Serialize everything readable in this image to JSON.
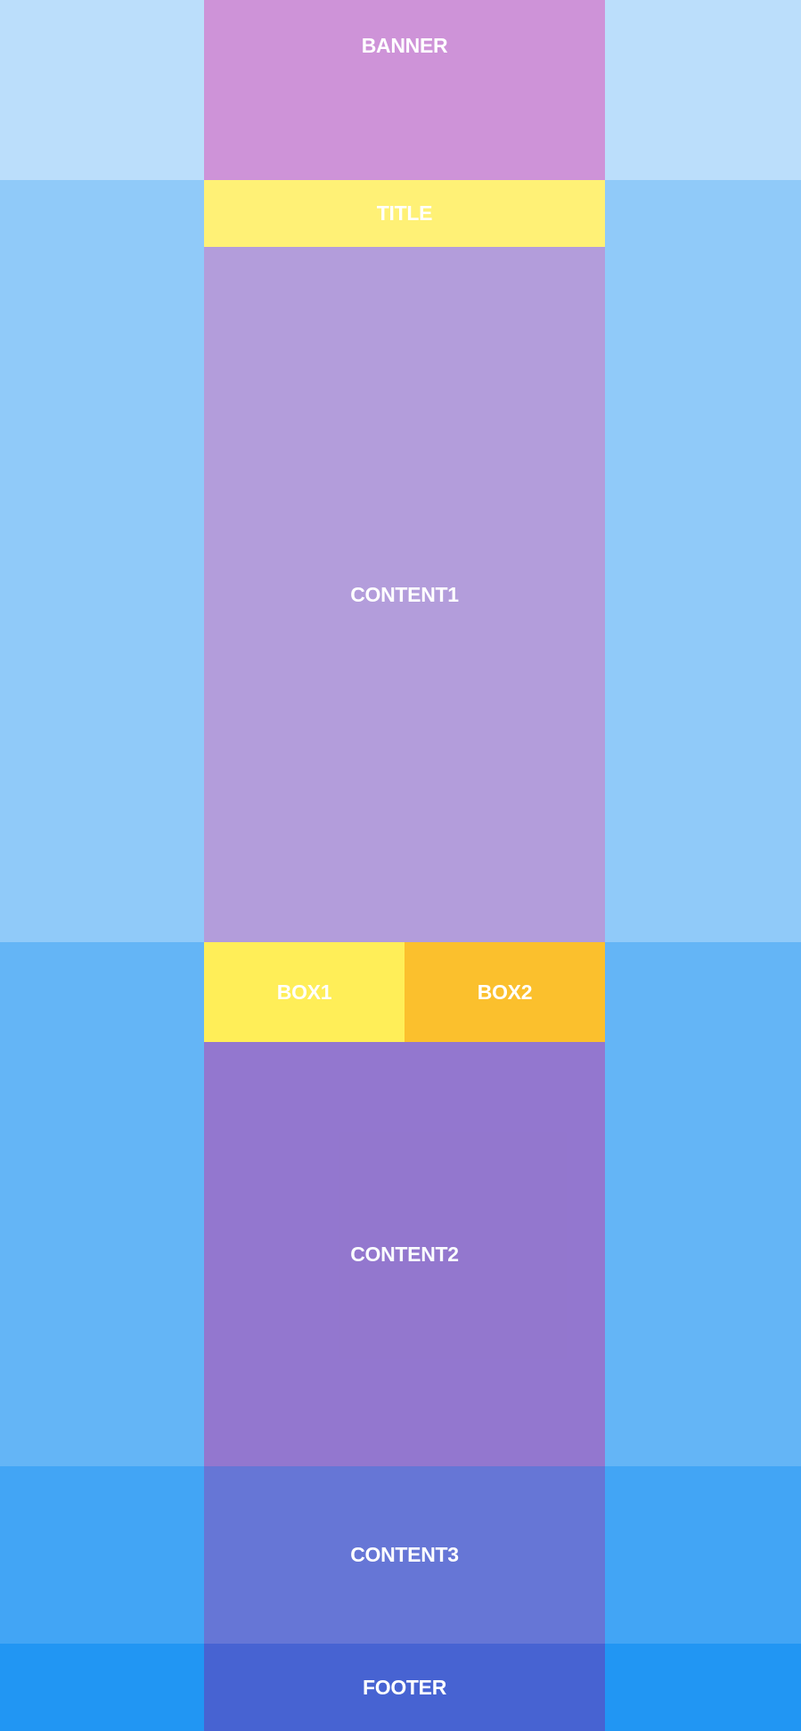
{
  "blocks": {
    "banner": "BANNER",
    "title": "TITLE",
    "content1": "CONTENT1",
    "box1": "BOX1",
    "box2": "BOX2",
    "content2": "CONTENT2",
    "content3": "CONTENT3",
    "footer": "FOOTER"
  }
}
